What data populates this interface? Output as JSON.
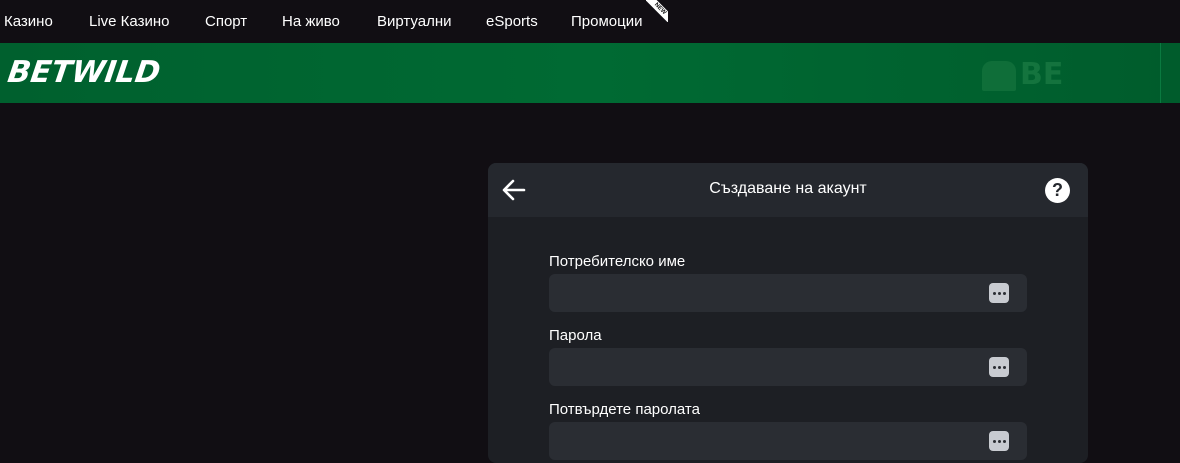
{
  "nav": {
    "items": [
      "Казино",
      "Live Казино",
      "Спорт",
      "На живо",
      "Виртуални",
      "eSports",
      "Промоции"
    ],
    "new_badge": "NEW"
  },
  "brand": {
    "logo": "BETWILD",
    "watermark": "BE"
  },
  "form": {
    "title": "Създаване на акаунт",
    "help": "?",
    "fields": [
      {
        "label": "Потребителско име",
        "value": ""
      },
      {
        "label": "Парола",
        "value": ""
      },
      {
        "label": "Потвърдете паролата",
        "value": ""
      }
    ]
  },
  "colors": {
    "page_bg": "#110e13",
    "brand_green": "#006a33",
    "panel_bg": "#1d1f24",
    "input_bg": "#2a2d33"
  },
  "icons": [
    "arrow-left-icon",
    "help-circle-icon",
    "password-dots-icon"
  ]
}
